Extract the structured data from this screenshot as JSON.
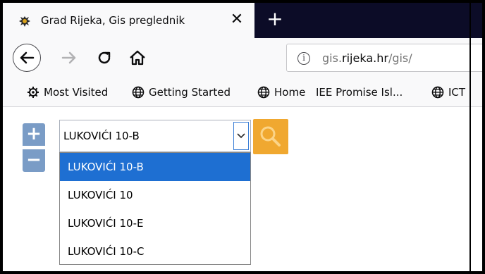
{
  "tab": {
    "title": "Grad Rijeka, Gis preglednik",
    "close": "✕",
    "new_tab": "+"
  },
  "nav": {
    "url_prefix": "gis.",
    "url_domain": "rijeka.hr",
    "url_suffix": "/gis/"
  },
  "bookmarks": [
    {
      "label": "Most Visited",
      "icon": "gear-icon"
    },
    {
      "label": "Getting Started",
      "icon": "globe-icon"
    },
    {
      "label": "Home",
      "icon": "globe-icon"
    },
    {
      "label": "IEE Promise Isl...",
      "icon": "none"
    },
    {
      "label": "ICT",
      "icon": "globe-icon"
    }
  ],
  "map_controls": {
    "zoom_in": "+",
    "zoom_out": "−"
  },
  "search": {
    "selected_value": "LUKOVIĆI 10-B",
    "options": [
      "LUKOVIĆI 10-B",
      "LUKOVIĆI 10",
      "LUKOVIĆI 10-E",
      "LUKOVIĆI 10-C"
    ],
    "highlighted_index": 0
  },
  "colors": {
    "tabstrip": "#0c0c27",
    "highlight": "#1e6fd2",
    "zoom_button": "#7a9cc6",
    "search_button": "#f0a830"
  }
}
